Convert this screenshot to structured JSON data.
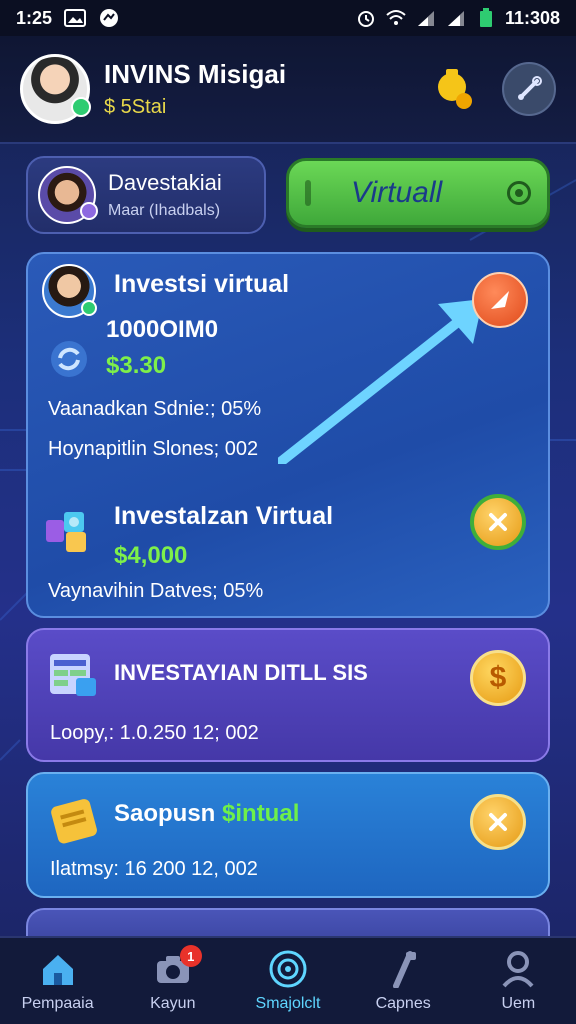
{
  "status_bar": {
    "time_left": "1:25",
    "time_right": "11:308",
    "battery_color": "#2ecc71"
  },
  "header": {
    "name": "INVINS Misigai",
    "balance": "$ 5Stai"
  },
  "profile": {
    "name": "Davestakiai",
    "subtitle": "Maar (Ihadbals)"
  },
  "virtual_button": {
    "label": "Virtuall"
  },
  "main_card": {
    "title": "Investsi virtual",
    "code": "1000OIM0",
    "amount": "$3.30",
    "line1": "Vaanadkan Sdnie:; 05%",
    "line2": "Hoynapitlin Slones; 002",
    "title2": "Investalzan Virtual",
    "amount2": "$4,000",
    "line3": "Vaynavihin Datves; 05%"
  },
  "purple_card": {
    "title": "INVESTAYIAN DITLL SIS",
    "line": "Loopy,: 1.0.250 12; 002",
    "coin_symbol": "$"
  },
  "blue_card": {
    "title_prefix": "Saopusn",
    "title_highlight": "$intual",
    "line": "Ilatmsy: 16 200 12, 002"
  },
  "nav": [
    {
      "label": "Pempaaia",
      "icon": "home-icon",
      "active": false
    },
    {
      "label": "Kayun",
      "icon": "camera-icon",
      "active": false,
      "badge": "1"
    },
    {
      "label": "Smajolclt",
      "icon": "target-icon",
      "active": true
    },
    {
      "label": "Capnes",
      "icon": "tool-icon",
      "active": false
    },
    {
      "label": "Uem",
      "icon": "user-icon",
      "active": false
    }
  ]
}
